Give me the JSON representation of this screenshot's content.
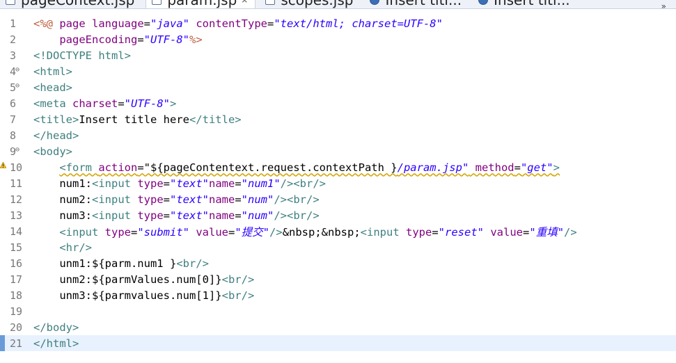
{
  "tabs": [
    {
      "label": "pageContext.jsp",
      "icon": "jsp-file-icon",
      "active": false
    },
    {
      "label": "param.jsp",
      "icon": "jsp-file-icon",
      "active": true,
      "close": "⨯"
    },
    {
      "label": "scopes.jsp",
      "icon": "jsp-file-icon",
      "active": false
    },
    {
      "label": "Insert titl...",
      "icon": "web-browser-icon",
      "active": false
    },
    {
      "label": "Insert titl...",
      "icon": "web-browser-icon",
      "active": false
    }
  ],
  "tab_overflow": "»",
  "line_numbers": [
    "1",
    "2",
    "3",
    "4",
    "5",
    "6",
    "7",
    "8",
    "9",
    "10",
    "11",
    "12",
    "13",
    "14",
    "15",
    "16",
    "17",
    "18",
    "19",
    "20",
    "21"
  ],
  "code": {
    "l1": [
      "<%@",
      " page ",
      "language",
      "=",
      "\"java\"",
      " ",
      "contentType",
      "=",
      "\"text/html; charset=UTF-8\""
    ],
    "l2": [
      "    ",
      "pageEncoding",
      "=",
      "\"UTF-8\"",
      "%>"
    ],
    "l3": [
      "<!DOCTYPE html>"
    ],
    "l4": [
      "<html>"
    ],
    "l5": [
      "<head>"
    ],
    "l6": [
      "<meta ",
      "charset",
      "=",
      "\"UTF-8\"",
      ">"
    ],
    "l7": [
      "<title>",
      "Insert title here",
      "</title>"
    ],
    "l8": [
      "</head>"
    ],
    "l9": [
      "<body>"
    ],
    "l10": [
      "    ",
      "<form ",
      "action",
      "=",
      "\"${pageContentext.request.contextPath }",
      "/param.jsp\"",
      " ",
      "method",
      "=",
      "\"get\"",
      ">"
    ],
    "l11": [
      "    num1:",
      "<input ",
      "type",
      "=",
      "\"text\"",
      "name",
      "=",
      "\"num1\"",
      "/>",
      "<br/>"
    ],
    "l12": [
      "    num2:",
      "<input ",
      "type",
      "=",
      "\"text\"",
      "name",
      "=",
      "\"num\"",
      "/>",
      "<br/>"
    ],
    "l13": [
      "    num3:",
      "<input ",
      "type",
      "=",
      "\"text\"",
      "name",
      "=",
      "\"num\"",
      "/>",
      "<br/>"
    ],
    "l14": [
      "    ",
      "<input ",
      "type",
      "=",
      "\"submit\"",
      " ",
      "value",
      "=",
      "\"提交\"",
      "/>",
      "&nbsp;&nbsp;",
      "<input ",
      "type",
      "=",
      "\"reset\"",
      " ",
      "value",
      "=",
      "\"重填\"",
      "/>"
    ],
    "l15": [
      "    ",
      "<hr/>"
    ],
    "l16": [
      "    unm1:${parm.num1 }",
      "<br/>"
    ],
    "l17": [
      "    unm2:${parmValues.num[0]}",
      "<br/>"
    ],
    "l18": [
      "    unm3:${parmvalues.num[1]}",
      "<br/>"
    ],
    "l19": [
      ""
    ],
    "l20": [
      "</body>"
    ],
    "l21": [
      "</html>"
    ]
  },
  "colors": {
    "tag": "#3f7f7f",
    "attribute": "#7f007f",
    "string": "#2a00ff",
    "jsp": "#bf5f3f",
    "current_line": "#e8f2fe"
  }
}
